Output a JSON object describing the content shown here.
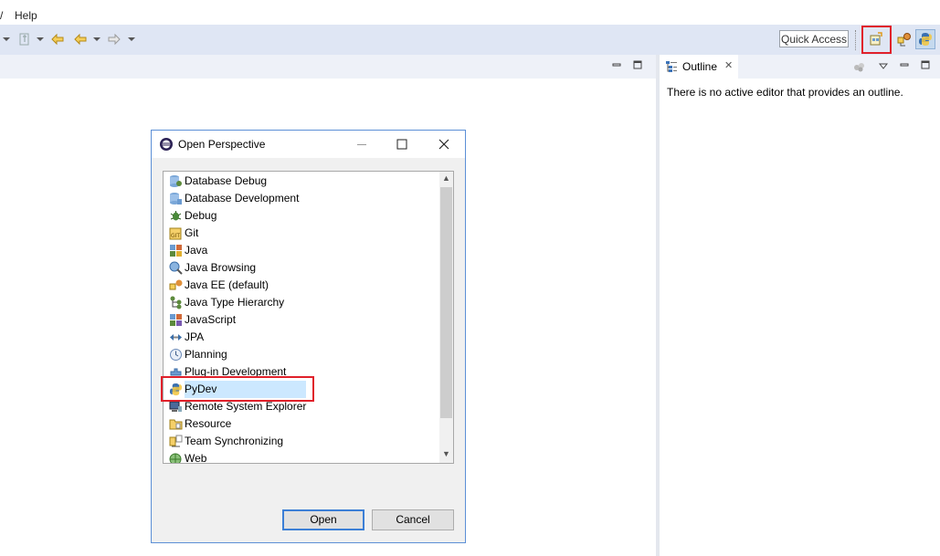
{
  "menubar": {
    "partial_item": "/",
    "help": "Help"
  },
  "toolbar": {
    "quick_access": "Quick Access",
    "icons": [
      "pin-icon",
      "back-edit-icon",
      "back-icon",
      "forward-icon",
      "open-perspective-icon",
      "java-ee-perspective-icon",
      "pydev-perspective-icon"
    ]
  },
  "outline": {
    "tab_label": "Outline",
    "message": "There is no active editor that provides an outline."
  },
  "dialog": {
    "title": "Open Perspective",
    "items": [
      {
        "label": "Database Debug",
        "icon": "database-debug-icon"
      },
      {
        "label": "Database Development",
        "icon": "database-development-icon"
      },
      {
        "label": "Debug",
        "icon": "bug-icon"
      },
      {
        "label": "Git",
        "icon": "git-icon"
      },
      {
        "label": "Java",
        "icon": "java-icon"
      },
      {
        "label": "Java Browsing",
        "icon": "java-browsing-icon"
      },
      {
        "label": "Java EE (default)",
        "icon": "java-ee-icon"
      },
      {
        "label": "Java Type Hierarchy",
        "icon": "type-hierarchy-icon"
      },
      {
        "label": "JavaScript",
        "icon": "javascript-icon"
      },
      {
        "label": "JPA",
        "icon": "jpa-icon"
      },
      {
        "label": "Planning",
        "icon": "planning-icon"
      },
      {
        "label": "Plug-in Development",
        "icon": "plugin-icon"
      },
      {
        "label": "PyDev",
        "icon": "python-icon"
      },
      {
        "label": "Remote System Explorer",
        "icon": "remote-system-icon"
      },
      {
        "label": "Resource",
        "icon": "resource-icon"
      },
      {
        "label": "Team Synchronizing",
        "icon": "team-sync-icon"
      },
      {
        "label": "Web",
        "icon": "web-icon"
      }
    ],
    "selected": "PyDev",
    "open_button": "Open",
    "cancel_button": "Cancel"
  },
  "colors": {
    "highlight": "#e0202a",
    "selection": "#cce8ff",
    "toolbar_bg": "#dfe6f4",
    "accent": "#3c7fd6"
  }
}
